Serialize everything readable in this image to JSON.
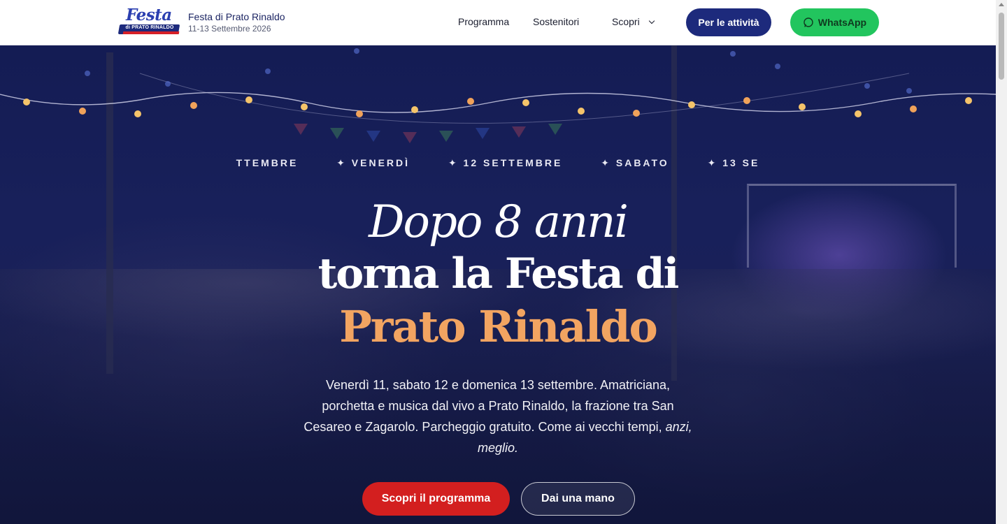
{
  "brand": {
    "logo_script": "Festa",
    "logo_ribbon": "di PRATO RINALDO",
    "title": "Festa di Prato Rinaldo",
    "dates": "11-13 Settembre 2026"
  },
  "nav": {
    "programma": "Programma",
    "sostenitori": "Sostenitori",
    "scopri": "Scopri",
    "attivita": "Per le attività",
    "whatsapp": "WhatsApp"
  },
  "hero": {
    "marquee": [
      "TTEMBRE",
      "✦ VENERDÌ",
      "✦ 12 SETTEMBRE",
      "✦ SABATO",
      "✦ 13 SE"
    ],
    "heading_line1": "Dopo 8 anni",
    "heading_line2": "torna la Festa di",
    "heading_line3": "Prato Rinaldo",
    "lead": "Venerdì 11, sabato 12 e domenica 13 settembre. Amatriciana, porchetta e musica dal vivo a Prato Rinaldo, la frazione tra San Cesareo e Zagarolo. Parcheggio gratuito. Come ai vecchi tempi,",
    "lead_em": "anzi, meglio.",
    "cta_primary": "Scopri il programma",
    "cta_secondary": "Dai una mano"
  },
  "colors": {
    "navy": "#1d2a7c",
    "whatsapp_green": "#22c55e",
    "cta_red": "#d31f1f",
    "accent_orange": "#f2a461"
  }
}
